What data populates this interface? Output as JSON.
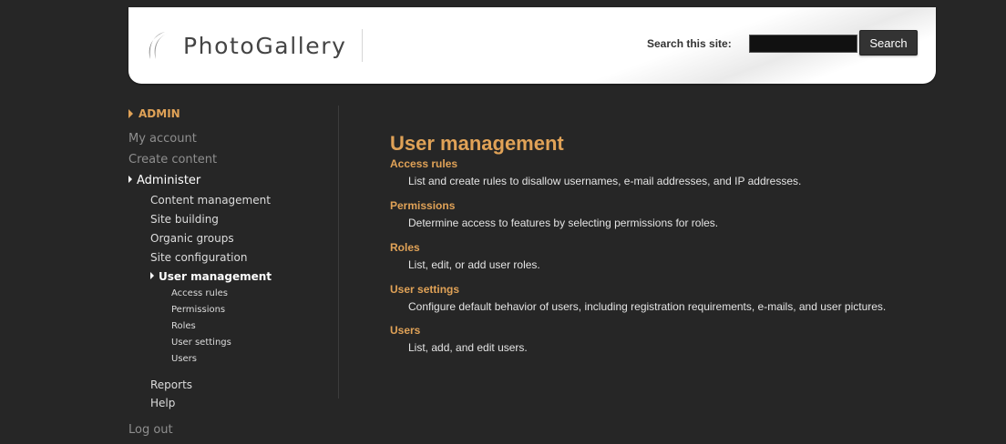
{
  "header": {
    "logo_text": "PhotoGallery",
    "search_label": "Search this site:",
    "search_value": "",
    "search_button": "Search"
  },
  "sidebar": {
    "block_title": "ADMIN",
    "items": {
      "my_account": "My account",
      "create_content": "Create content",
      "administer": "Administer",
      "content_management": "Content management",
      "site_building": "Site building",
      "organic_groups": "Organic groups",
      "site_configuration": "Site configuration",
      "user_management": "User management",
      "access_rules": "Access rules",
      "permissions": "Permissions",
      "roles": "Roles",
      "user_settings": "User settings",
      "users": "Users",
      "reports": "Reports",
      "help": "Help",
      "log_out": "Log out"
    }
  },
  "main": {
    "title": "User management",
    "entries": [
      {
        "title": "Access rules",
        "description": "List and create rules to disallow usernames, e-mail addresses, and IP addresses."
      },
      {
        "title": "Permissions",
        "description": "Determine access to features by selecting permissions for roles."
      },
      {
        "title": "Roles",
        "description": "List, edit, or add user roles."
      },
      {
        "title": "User settings",
        "description": "Configure default behavior of users, including registration requirements, e-mails, and user pictures."
      },
      {
        "title": "Users",
        "description": "List, add, and edit users."
      }
    ]
  },
  "colors": {
    "background": "#262626",
    "accent": "#e0a257",
    "header_bg": "#ffffff"
  },
  "icons": {
    "logo": "crescent-swoosh-icon",
    "block_bullet": "triangle-right-icon",
    "active_arrow": "triangle-right-icon"
  }
}
